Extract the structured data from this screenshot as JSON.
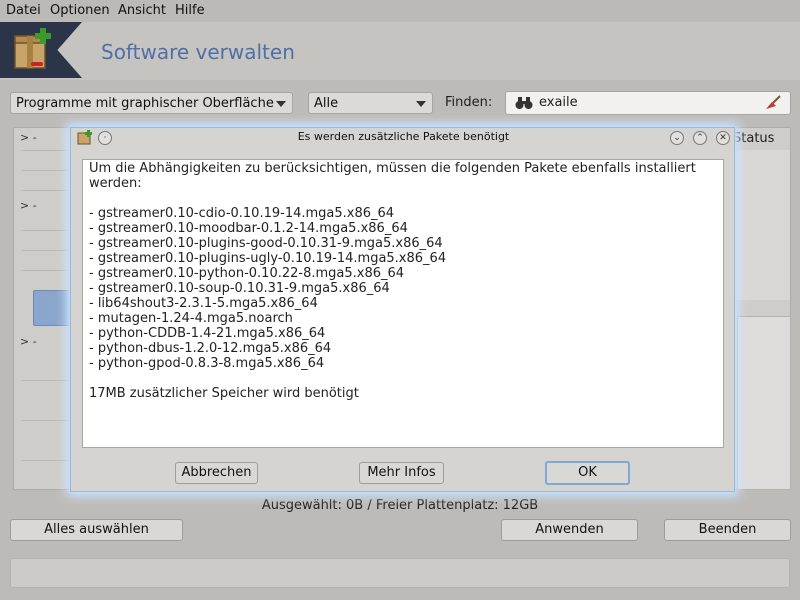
{
  "menubar": {
    "items": [
      {
        "label": "Datei",
        "accel": "D"
      },
      {
        "label": "Optionen",
        "accel": "O"
      },
      {
        "label": "Ansicht",
        "accel": "s"
      },
      {
        "label": "Hilfe",
        "accel": "H"
      }
    ]
  },
  "header": {
    "title": "Software verwalten",
    "logo_icon": "package-add-icon"
  },
  "filters": {
    "category": "Programme mit graphischer Oberfläche",
    "status": "Alle",
    "find_label": "Finden:",
    "search_value": "exaile",
    "search_icon": "binoculars-icon",
    "clear_icon": "clear-broom-icon"
  },
  "table": {
    "status_header": "Status"
  },
  "status_line": "Ausgewählt: 0B / Freier Plattenplatz: 12GB",
  "buttons": {
    "select_all": "Alles auswählen",
    "apply": "Anwenden",
    "quit": "Beenden"
  },
  "dialog": {
    "title": "Es werden zusätzliche Pakete benötigt",
    "intro_line1": "Um die Abhängigkeiten zu berücksichtigen, müssen die folgenden Pakete ebenfalls installiert",
    "intro_line2": "werden:",
    "packages": [
      "- gstreamer0.10-cdio-0.10.19-14.mga5.x86_64",
      "- gstreamer0.10-moodbar-0.1.2-14.mga5.x86_64",
      "- gstreamer0.10-plugins-good-0.10.31-9.mga5.x86_64",
      "- gstreamer0.10-plugins-ugly-0.10.19-14.mga5.x86_64",
      "- gstreamer0.10-python-0.10.22-8.mga5.x86_64",
      "- gstreamer0.10-soup-0.10.31-9.mga5.x86_64",
      "- lib64shout3-2.3.1-5.mga5.x86_64",
      "- mutagen-1.24-4.mga5.noarch",
      "- python-CDDB-1.4-21.mga5.x86_64",
      "- python-dbus-1.2.0-12.mga5.x86_64",
      "- python-gpod-0.8.3-8.mga5.x86_64"
    ],
    "size_note": "17MB zusätzlicher Speicher wird benötigt",
    "btn_cancel": "Abbrechen",
    "btn_more": "Mehr Infos",
    "btn_ok": "OK"
  },
  "colors": {
    "accent": "#4f6fa8",
    "dialog_glow": "#cde4ff"
  }
}
